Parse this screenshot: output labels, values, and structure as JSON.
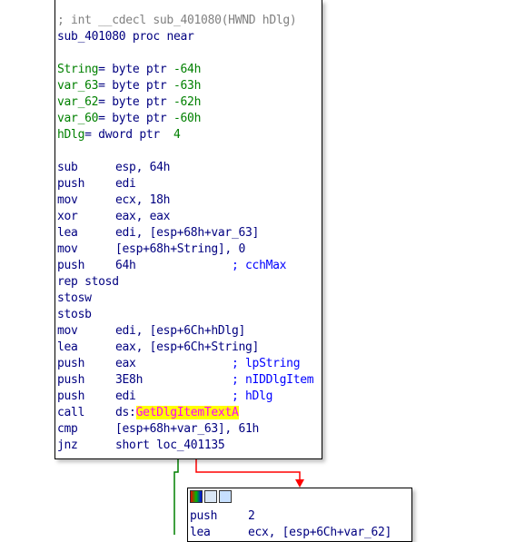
{
  "header": {
    "comment": "; int __cdecl sub_401080(HWND hDlg)",
    "proc_name": "sub_401080",
    "proc_kw": "proc near"
  },
  "vars": [
    {
      "name": "String",
      "sep": "= ",
      "type": "byte ptr",
      "off": "-64h"
    },
    {
      "name": "var_63",
      "sep": "= ",
      "type": "byte ptr",
      "off": "-63h"
    },
    {
      "name": "var_62",
      "sep": "= ",
      "type": "byte ptr",
      "off": "-62h"
    },
    {
      "name": "var_60",
      "sep": "= ",
      "type": "byte ptr",
      "off": "-60h"
    },
    {
      "name": "hDlg",
      "sep": "= ",
      "type": "dword ptr",
      "off": " 4"
    }
  ],
  "instructions": [
    {
      "mn": "sub",
      "op": "esp, 64h",
      "comment": ""
    },
    {
      "mn": "push",
      "op": "edi",
      "comment": ""
    },
    {
      "mn": "mov",
      "op": "ecx, 18h",
      "comment": ""
    },
    {
      "mn": "xor",
      "op": "eax, eax",
      "comment": ""
    },
    {
      "mn": "lea",
      "op": "edi, [esp+68h+var_63]",
      "comment": ""
    },
    {
      "mn": "mov",
      "op": "[esp+68h+String], 0",
      "comment": ""
    },
    {
      "mn": "push",
      "op": "64h",
      "comment": "; cchMax"
    },
    {
      "mn": "rep stosd",
      "op": "",
      "comment": ""
    },
    {
      "mn": "stosw",
      "op": "",
      "comment": ""
    },
    {
      "mn": "stosb",
      "op": "",
      "comment": ""
    },
    {
      "mn": "mov",
      "op": "edi, [esp+6Ch+hDlg]",
      "comment": ""
    },
    {
      "mn": "lea",
      "op": "eax, [esp+6Ch+String]",
      "comment": ""
    },
    {
      "mn": "push",
      "op": "eax",
      "comment": "; lpString"
    },
    {
      "mn": "push",
      "op": "3E8h",
      "comment": "; nIDDlgItem"
    },
    {
      "mn": "push",
      "op": "edi",
      "comment": "; hDlg"
    },
    {
      "mn": "call",
      "op_prefix": "ds:",
      "op_hl": "GetDlgItemTextA",
      "comment": ""
    },
    {
      "mn": "cmp",
      "op": "[esp+68h+var_63], 61h",
      "comment": ""
    },
    {
      "mn": "jnz",
      "op": "short loc_401135",
      "comment": ""
    }
  ],
  "next_block": {
    "lines": [
      {
        "mn": "push",
        "op": "2"
      },
      {
        "mn": "lea",
        "op": "ecx, [esp+6Ch+var_62]"
      }
    ]
  },
  "colors": {
    "edge_true": "#008000",
    "edge_false": "#ff0000",
    "label": "#000080",
    "var_name": "#008000",
    "highlight": "#ffff00"
  }
}
